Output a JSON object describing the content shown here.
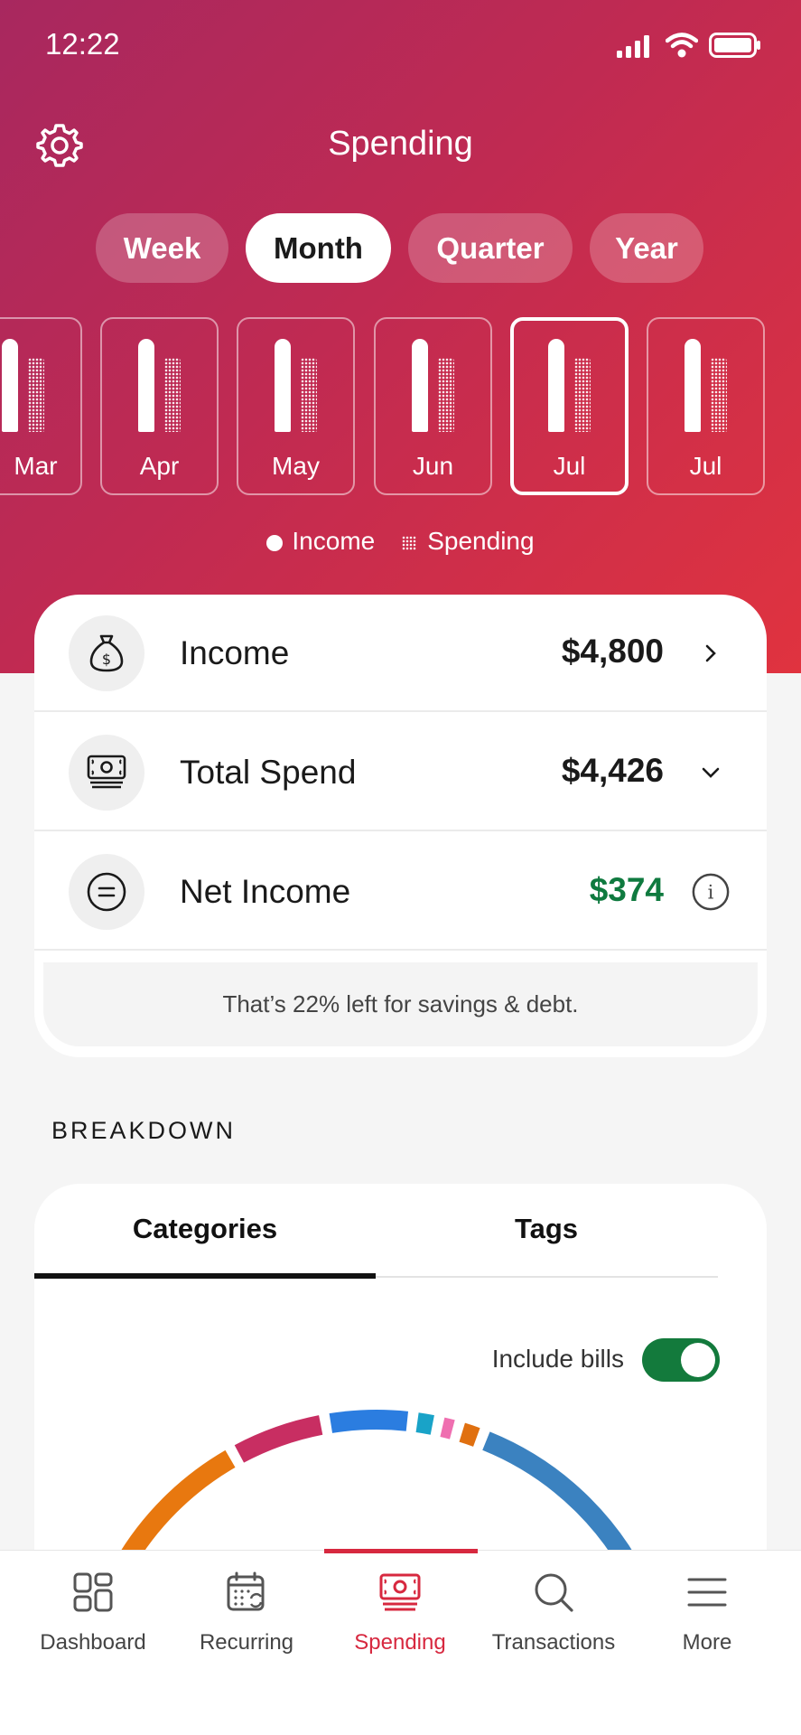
{
  "status_bar": {
    "time": "12:22"
  },
  "header": {
    "title": "Spending",
    "settings_icon": "gear-icon"
  },
  "periods": [
    {
      "label": "Week",
      "active": false
    },
    {
      "label": "Month",
      "active": true
    },
    {
      "label": "Quarter",
      "active": false
    },
    {
      "label": "Year",
      "active": false
    }
  ],
  "months": [
    {
      "label": "Mar"
    },
    {
      "label": "Apr"
    },
    {
      "label": "May"
    },
    {
      "label": "Jun"
    },
    {
      "label": "Jul",
      "selected": true
    },
    {
      "label": "Jul"
    }
  ],
  "legend": {
    "income": "Income",
    "spending": "Spending"
  },
  "summary": {
    "income": {
      "label": "Income",
      "value": "$4,800"
    },
    "total_spend": {
      "label": "Total Spend",
      "value": "$4,426"
    },
    "net_income": {
      "label": "Net Income",
      "value": "$374",
      "color": "#0f7a3f"
    },
    "note": "That’s 22% left for savings & debt."
  },
  "breakdown": {
    "heading": "BREAKDOWN",
    "tabs": [
      {
        "label": "Categories",
        "active": true
      },
      {
        "label": "Tags",
        "active": false
      }
    ],
    "include_bills_label": "Include bills",
    "include_bills_on": true,
    "segment_colors": [
      "#e8780f",
      "#c82e62",
      "#2b7de0",
      "#19a3c8",
      "#ef6fb0",
      "#e07010",
      "#3b82c0"
    ]
  },
  "nav": [
    {
      "label": "Dashboard",
      "icon": "dashboard-icon"
    },
    {
      "label": "Recurring",
      "icon": "calendar-recurring-icon"
    },
    {
      "label": "Spending",
      "icon": "cash-icon",
      "active": true
    },
    {
      "label": "Transactions",
      "icon": "search-icon"
    },
    {
      "label": "More",
      "icon": "menu-icon"
    }
  ],
  "colors": {
    "brand": "#d7283f",
    "positive": "#0f7a3f",
    "toggle_on": "#137a3c"
  }
}
